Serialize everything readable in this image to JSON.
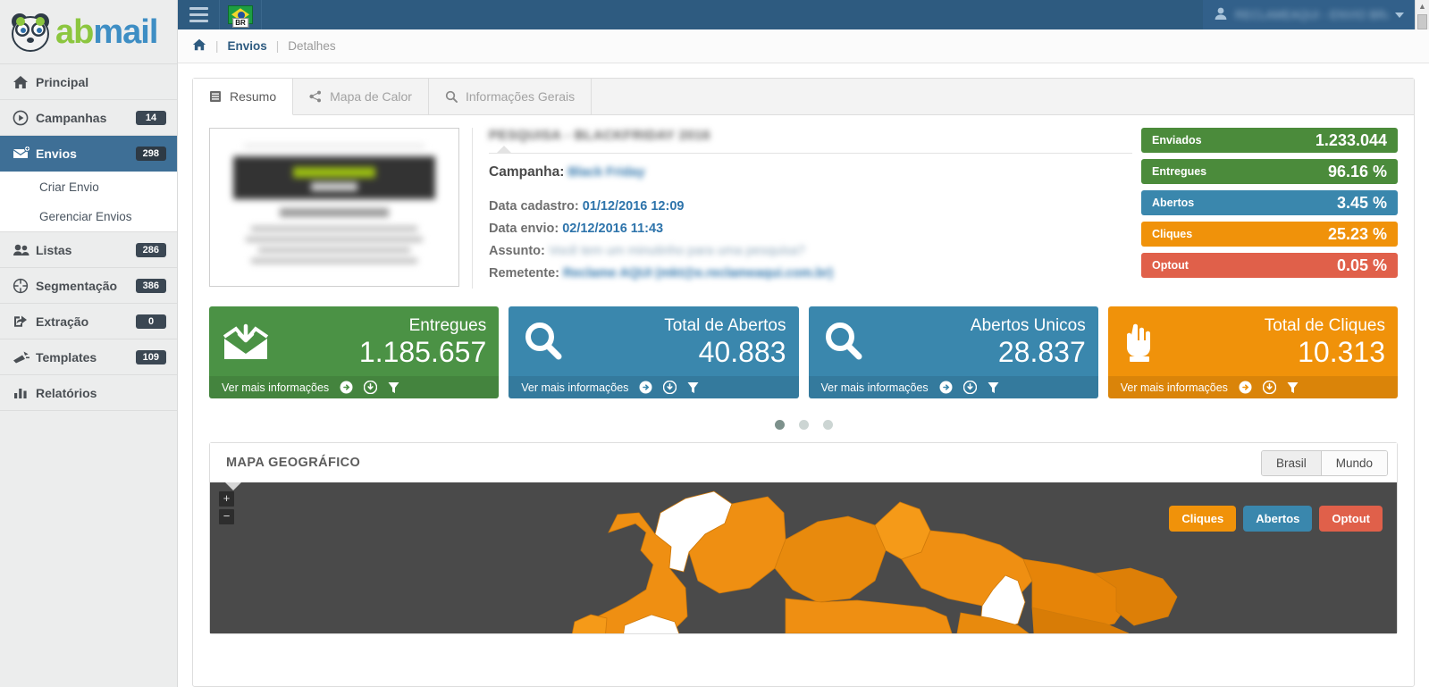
{
  "brand": {
    "name_part1": "ab",
    "name_part2": "mail",
    "logo_icon": "panda-logo-icon"
  },
  "sidebar": {
    "items": [
      {
        "label": "Principal",
        "badge": null,
        "icon": "home-icon",
        "active": false
      },
      {
        "label": "Campanhas",
        "badge": "14",
        "icon": "play-circle-icon",
        "active": false
      },
      {
        "label": "Envios",
        "badge": "298",
        "icon": "envelope-plus-icon",
        "active": true
      },
      {
        "label": "Listas",
        "badge": "286",
        "icon": "users-icon",
        "active": false
      },
      {
        "label": "Segmentação",
        "badge": "386",
        "icon": "target-icon",
        "active": false
      },
      {
        "label": "Extração",
        "badge": "0",
        "icon": "share-export-icon",
        "active": false
      },
      {
        "label": "Templates",
        "badge": "109",
        "icon": "templates-icon",
        "active": false
      },
      {
        "label": "Relatórios",
        "badge": null,
        "icon": "bar-chart-icon",
        "active": false
      }
    ],
    "submenu": [
      {
        "label": "Criar Envio"
      },
      {
        "label": "Gerenciar Envios"
      }
    ]
  },
  "topbar": {
    "menu_icon": "hamburger-icon",
    "language_flag": "brazil-flag-icon",
    "language_code": "BR",
    "user_icon": "user-icon",
    "user_name": "RECLAMEAQUI - ENVIO BRASIL",
    "caret_icon": "chevron-down-icon"
  },
  "breadcrumb": {
    "home_icon": "home-icon",
    "separator": "|",
    "link": "Envios",
    "current": "Detalhes"
  },
  "tabs": [
    {
      "label": "Resumo",
      "icon": "list-icon",
      "active": true
    },
    {
      "label": "Mapa de Calor",
      "icon": "share-nodes-icon",
      "active": false
    },
    {
      "label": "Informações Gerais",
      "icon": "search-icon",
      "active": false
    }
  ],
  "detail": {
    "title": "PESQUISA - BLACKFRIDAY 2016",
    "campaign_label": "Campanha:",
    "campaign_value": "Black Friday",
    "data_cadastro_label": "Data cadastro:",
    "data_cadastro_value": "01/12/2016 12:09",
    "data_envio_label": "Data envio:",
    "data_envio_value": "02/12/2016 11:43",
    "assunto_label": "Assunto:",
    "assunto_value": "Você tem um minutinho para uma pesquisa?",
    "remetente_label": "Remetente:",
    "remetente_value": "Reclame AQUI (mkt@e.reclameaqui.com.br)"
  },
  "statbars": [
    {
      "label": "Enviados",
      "value": "1.233.044",
      "color": "#4b8b3b"
    },
    {
      "label": "Entregues",
      "value": "96.16 %",
      "color": "#4b8b3b"
    },
    {
      "label": "Abertos",
      "value": "3.45 %",
      "color": "#3a87ad"
    },
    {
      "label": "Cliques",
      "value": "25.23 %",
      "color": "#f0920a"
    },
    {
      "label": "Optout",
      "value": "0.05 %",
      "color": "#e0604a"
    }
  ],
  "cards": [
    {
      "title": "Entregues",
      "value": "1.185.657",
      "color": "#4b9245",
      "icon": "envelope-download-icon",
      "footer": "Ver mais informações"
    },
    {
      "title": "Total de Abertos",
      "value": "40.883",
      "color": "#3a87ad",
      "icon": "search-icon",
      "footer": "Ver mais informações"
    },
    {
      "title": "Abertos Unicos",
      "value": "28.837",
      "color": "#3a87ad",
      "icon": "search-icon",
      "footer": "Ver mais informações"
    },
    {
      "title": "Total de Cliques",
      "value": "10.313",
      "color": "#f0920a",
      "icon": "hand-pointer-icon",
      "footer": "Ver mais informações"
    }
  ],
  "card_footer_icons": [
    "arrow-right-circle-icon",
    "download-circle-icon",
    "funnel-icon"
  ],
  "carousel": {
    "dots": 3,
    "active_index": 0
  },
  "map": {
    "title": "MAPA GEOGRÁFICO",
    "scope_buttons": [
      {
        "label": "Brasil",
        "selected": true
      },
      {
        "label": "Mundo",
        "selected": false
      }
    ],
    "zoom_in": "+",
    "zoom_out": "−",
    "legend": [
      {
        "label": "Cliques",
        "color": "#f0920a"
      },
      {
        "label": "Abertos",
        "color": "#3a87ad"
      },
      {
        "label": "Optout",
        "color": "#e0604a"
      }
    ],
    "background_color": "#4a4a4a",
    "region_color": "#ef8f12"
  }
}
